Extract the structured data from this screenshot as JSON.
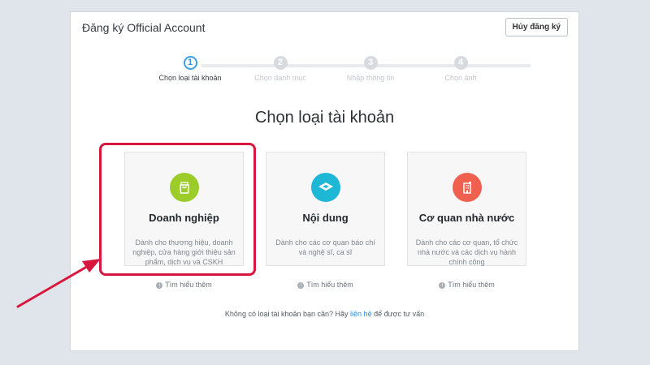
{
  "header": {
    "title": "Đăng ký Official Account",
    "cancel_label": "Hủy đăng ký"
  },
  "steps": [
    {
      "number": "1",
      "label": "Chọn loại tài khoản",
      "active": true
    },
    {
      "number": "2",
      "label": "Chọn danh mục",
      "active": false
    },
    {
      "number": "3",
      "label": "Nhập thông tin",
      "active": false
    },
    {
      "number": "4",
      "label": "Chọn ảnh",
      "active": false
    }
  ],
  "main": {
    "title": "Chọn loại tài khoản",
    "cards": [
      {
        "title": "Doanh nghiệp",
        "desc": "Dành cho thương hiệu, doanh nghiệp, cửa hàng giới thiệu sản phẩm, dịch vụ và CSKH",
        "icon": "shopping-bag-icon",
        "color": "#9ccc2a",
        "learn_more": "Tìm hiểu thêm"
      },
      {
        "title": "Nội dung",
        "desc": "Dành cho các cơ quan báo chí và nghệ sĩ, ca sĩ",
        "icon": "content-box-icon",
        "color": "#1eb8d6",
        "learn_more": "Tìm hiểu thêm"
      },
      {
        "title": "Cơ quan nhà nước",
        "desc": "Dành cho các cơ quan, tổ chức nhà nước và các dịch vụ hành chính công",
        "icon": "building-icon",
        "color": "#f0604f",
        "learn_more": "Tìm hiểu thêm"
      }
    ],
    "info_icon_glyph": "i"
  },
  "footer": {
    "prefix": "Không có loại tài khoản bạn cần? Hãy",
    "link": "liên hệ",
    "suffix": "để được tư vấn"
  },
  "annotation": {
    "highlight_color": "#d8173e"
  }
}
